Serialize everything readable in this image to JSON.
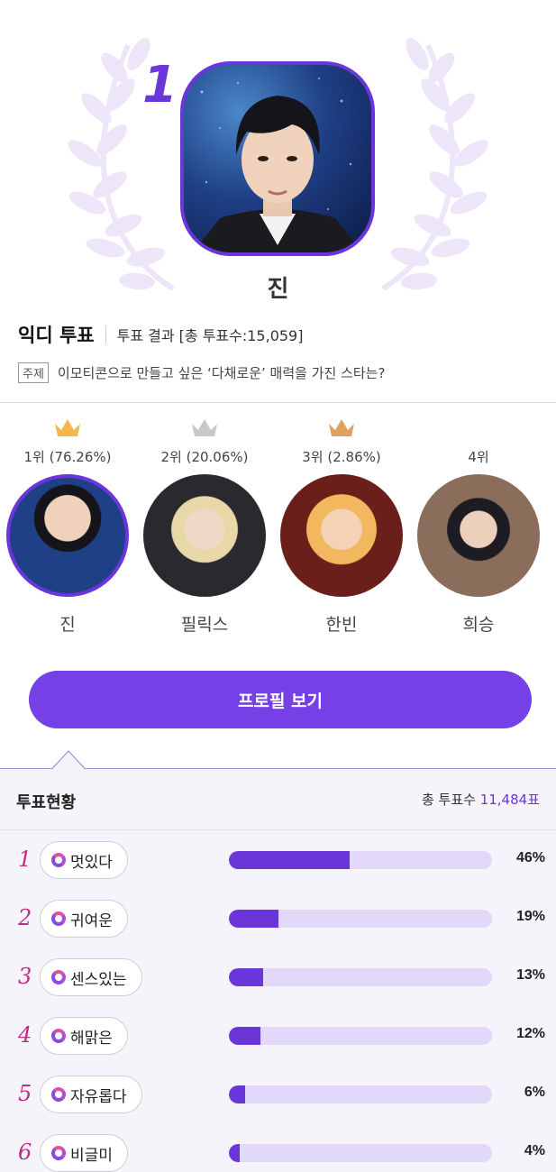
{
  "winner": {
    "rank": "1",
    "name": "진"
  },
  "vote": {
    "title": "익디 투표",
    "result_label": "투표 결과 [총 투표수:15,059]",
    "topic_badge": "주제",
    "topic_text": "이모티콘으로 만들고 싶은 ‘다채로운’ 매력을 가진 스타는?"
  },
  "candidates": [
    {
      "rank_label": "1위 (76.26%)",
      "name": "진",
      "crown": "gold-crown-icon",
      "crown_color": "#f2b84b"
    },
    {
      "rank_label": "2위 (20.06%)",
      "name": "필릭스",
      "crown": "silver-crown-icon",
      "crown_color": "#c8c8c8"
    },
    {
      "rank_label": "3위 (2.86%)",
      "name": "한빈",
      "crown": "bronze-crown-icon",
      "crown_color": "#e0a060"
    },
    {
      "rank_label": "4위",
      "name": "희승",
      "crown": ""
    }
  ],
  "profile_button": "프로필 보기",
  "status": {
    "title": "투표현황",
    "total_prefix": "총 투표수",
    "total_value": "11,484표",
    "items": [
      {
        "rank": "1",
        "label": "멋있다",
        "percent": 46,
        "percent_text": "46%"
      },
      {
        "rank": "2",
        "label": "귀여운",
        "percent": 19,
        "percent_text": "19%"
      },
      {
        "rank": "3",
        "label": "센스있는",
        "percent": 13,
        "percent_text": "13%"
      },
      {
        "rank": "4",
        "label": "해맑은",
        "percent": 12,
        "percent_text": "12%"
      },
      {
        "rank": "5",
        "label": "자유롭다",
        "percent": 6,
        "percent_text": "6%"
      },
      {
        "rank": "6",
        "label": "비글미",
        "percent": 4,
        "percent_text": "4%"
      }
    ]
  },
  "colors": {
    "accent": "#6a36d9",
    "button": "#7540e6",
    "bar_track": "#e2d9fa",
    "rank_number": "#c02c86"
  }
}
